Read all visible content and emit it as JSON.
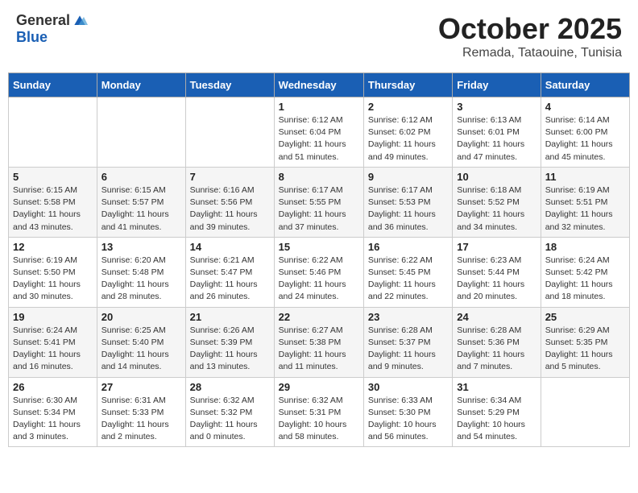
{
  "header": {
    "logo_general": "General",
    "logo_blue": "Blue",
    "month": "October 2025",
    "location": "Remada, Tataouine, Tunisia"
  },
  "weekdays": [
    "Sunday",
    "Monday",
    "Tuesday",
    "Wednesday",
    "Thursday",
    "Friday",
    "Saturday"
  ],
  "weeks": [
    [
      {
        "day": "",
        "info": ""
      },
      {
        "day": "",
        "info": ""
      },
      {
        "day": "",
        "info": ""
      },
      {
        "day": "1",
        "info": "Sunrise: 6:12 AM\nSunset: 6:04 PM\nDaylight: 11 hours\nand 51 minutes."
      },
      {
        "day": "2",
        "info": "Sunrise: 6:12 AM\nSunset: 6:02 PM\nDaylight: 11 hours\nand 49 minutes."
      },
      {
        "day": "3",
        "info": "Sunrise: 6:13 AM\nSunset: 6:01 PM\nDaylight: 11 hours\nand 47 minutes."
      },
      {
        "day": "4",
        "info": "Sunrise: 6:14 AM\nSunset: 6:00 PM\nDaylight: 11 hours\nand 45 minutes."
      }
    ],
    [
      {
        "day": "5",
        "info": "Sunrise: 6:15 AM\nSunset: 5:58 PM\nDaylight: 11 hours\nand 43 minutes."
      },
      {
        "day": "6",
        "info": "Sunrise: 6:15 AM\nSunset: 5:57 PM\nDaylight: 11 hours\nand 41 minutes."
      },
      {
        "day": "7",
        "info": "Sunrise: 6:16 AM\nSunset: 5:56 PM\nDaylight: 11 hours\nand 39 minutes."
      },
      {
        "day": "8",
        "info": "Sunrise: 6:17 AM\nSunset: 5:55 PM\nDaylight: 11 hours\nand 37 minutes."
      },
      {
        "day": "9",
        "info": "Sunrise: 6:17 AM\nSunset: 5:53 PM\nDaylight: 11 hours\nand 36 minutes."
      },
      {
        "day": "10",
        "info": "Sunrise: 6:18 AM\nSunset: 5:52 PM\nDaylight: 11 hours\nand 34 minutes."
      },
      {
        "day": "11",
        "info": "Sunrise: 6:19 AM\nSunset: 5:51 PM\nDaylight: 11 hours\nand 32 minutes."
      }
    ],
    [
      {
        "day": "12",
        "info": "Sunrise: 6:19 AM\nSunset: 5:50 PM\nDaylight: 11 hours\nand 30 minutes."
      },
      {
        "day": "13",
        "info": "Sunrise: 6:20 AM\nSunset: 5:48 PM\nDaylight: 11 hours\nand 28 minutes."
      },
      {
        "day": "14",
        "info": "Sunrise: 6:21 AM\nSunset: 5:47 PM\nDaylight: 11 hours\nand 26 minutes."
      },
      {
        "day": "15",
        "info": "Sunrise: 6:22 AM\nSunset: 5:46 PM\nDaylight: 11 hours\nand 24 minutes."
      },
      {
        "day": "16",
        "info": "Sunrise: 6:22 AM\nSunset: 5:45 PM\nDaylight: 11 hours\nand 22 minutes."
      },
      {
        "day": "17",
        "info": "Sunrise: 6:23 AM\nSunset: 5:44 PM\nDaylight: 11 hours\nand 20 minutes."
      },
      {
        "day": "18",
        "info": "Sunrise: 6:24 AM\nSunset: 5:42 PM\nDaylight: 11 hours\nand 18 minutes."
      }
    ],
    [
      {
        "day": "19",
        "info": "Sunrise: 6:24 AM\nSunset: 5:41 PM\nDaylight: 11 hours\nand 16 minutes."
      },
      {
        "day": "20",
        "info": "Sunrise: 6:25 AM\nSunset: 5:40 PM\nDaylight: 11 hours\nand 14 minutes."
      },
      {
        "day": "21",
        "info": "Sunrise: 6:26 AM\nSunset: 5:39 PM\nDaylight: 11 hours\nand 13 minutes."
      },
      {
        "day": "22",
        "info": "Sunrise: 6:27 AM\nSunset: 5:38 PM\nDaylight: 11 hours\nand 11 minutes."
      },
      {
        "day": "23",
        "info": "Sunrise: 6:28 AM\nSunset: 5:37 PM\nDaylight: 11 hours\nand 9 minutes."
      },
      {
        "day": "24",
        "info": "Sunrise: 6:28 AM\nSunset: 5:36 PM\nDaylight: 11 hours\nand 7 minutes."
      },
      {
        "day": "25",
        "info": "Sunrise: 6:29 AM\nSunset: 5:35 PM\nDaylight: 11 hours\nand 5 minutes."
      }
    ],
    [
      {
        "day": "26",
        "info": "Sunrise: 6:30 AM\nSunset: 5:34 PM\nDaylight: 11 hours\nand 3 minutes."
      },
      {
        "day": "27",
        "info": "Sunrise: 6:31 AM\nSunset: 5:33 PM\nDaylight: 11 hours\nand 2 minutes."
      },
      {
        "day": "28",
        "info": "Sunrise: 6:32 AM\nSunset: 5:32 PM\nDaylight: 11 hours\nand 0 minutes."
      },
      {
        "day": "29",
        "info": "Sunrise: 6:32 AM\nSunset: 5:31 PM\nDaylight: 10 hours\nand 58 minutes."
      },
      {
        "day": "30",
        "info": "Sunrise: 6:33 AM\nSunset: 5:30 PM\nDaylight: 10 hours\nand 56 minutes."
      },
      {
        "day": "31",
        "info": "Sunrise: 6:34 AM\nSunset: 5:29 PM\nDaylight: 10 hours\nand 54 minutes."
      },
      {
        "day": "",
        "info": ""
      }
    ]
  ]
}
